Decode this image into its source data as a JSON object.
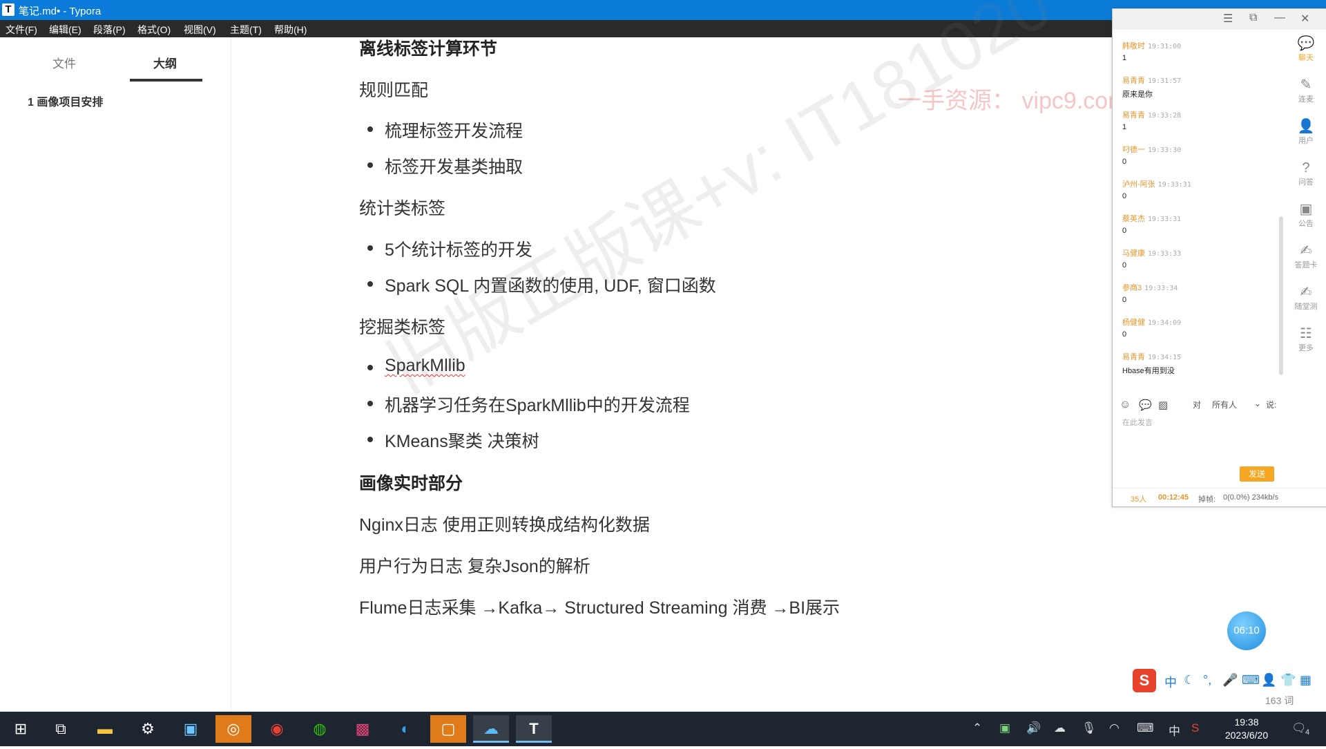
{
  "window": {
    "app_icon": "T",
    "title": "笔记.md• - Typora"
  },
  "menu": [
    "文件(F)",
    "编辑(E)",
    "段落(P)",
    "格式(O)",
    "视图(V)",
    "主题(T)",
    "帮助(H)"
  ],
  "sidebar": {
    "tabs": [
      "文件",
      "大纲"
    ],
    "active_tab": "大纲",
    "outline": [
      "1 画像项目安排"
    ],
    "bottom": {
      "back": "‹",
      "source": "</>"
    }
  },
  "editor": {
    "lines": [
      {
        "kind": "heading",
        "text": "离线标签计算环节"
      },
      {
        "kind": "para",
        "text": "规则匹配"
      },
      {
        "kind": "bullet",
        "text": "梳理标签开发流程"
      },
      {
        "kind": "bullet",
        "text": "标签开发基类抽取"
      },
      {
        "kind": "para",
        "text": "统计类标签"
      },
      {
        "kind": "bullet",
        "text": "5个统计标签的开发"
      },
      {
        "kind": "bullet",
        "text": "Spark SQL 内置函数的使用, UDF, 窗口函数"
      },
      {
        "kind": "para",
        "text": "挖掘类标签"
      },
      {
        "kind": "bullet",
        "text": "SparkMllib"
      },
      {
        "kind": "bullet",
        "text": "机器学习任务在SparkMllib中的开发流程"
      },
      {
        "kind": "bullet",
        "text": "KMeans聚类 决策树"
      },
      {
        "kind": "heading",
        "text": "画像实时部分"
      },
      {
        "kind": "para",
        "text": "Nginx日志  使用正则转换成结构化数据"
      },
      {
        "kind": "para",
        "text": "用户行为日志  复杂Json的解析"
      },
      {
        "kind": "para",
        "text": "Flume日志采集 →Kafka→ Structured Streaming 消费 →BI展示"
      }
    ],
    "watermark": "旧版正版课+v: IT181020",
    "resource_mark": "一手资源：  vipc9.com",
    "word_count": "163 词"
  },
  "chat": {
    "messages": [
      {
        "name": "韩敬时",
        "time": "19:31:00",
        "text": "1"
      },
      {
        "name": "易青青",
        "time": "19:31:57",
        "text": "原来是你"
      },
      {
        "name": "易青青",
        "time": "19:33:28",
        "text": "1"
      },
      {
        "name": "叼德一",
        "time": "19:33:30",
        "text": "0"
      },
      {
        "name": "泸州-阿张",
        "time": "19:33:31",
        "text": "0"
      },
      {
        "name": "蔡英杰",
        "time": "19:33:31",
        "text": "0"
      },
      {
        "name": "马健康",
        "time": "19:33:33",
        "text": "0"
      },
      {
        "name": "参商3",
        "time": "19:33:34",
        "text": "0"
      },
      {
        "name": "杨健健",
        "time": "19:34:09",
        "text": "0"
      },
      {
        "name": "易青青",
        "time": "19:34:15",
        "text": "Hbase有用到没"
      }
    ],
    "nav": [
      {
        "icon": "chat-icon",
        "glyph": "💬",
        "label": "聊天",
        "active": true
      },
      {
        "icon": "mic-icon",
        "glyph": "✎",
        "label": "连麦",
        "active": false
      },
      {
        "icon": "user-icon",
        "glyph": "👤",
        "label": "用户",
        "active": false
      },
      {
        "icon": "question-icon",
        "glyph": "?",
        "label": "问答",
        "active": false
      },
      {
        "icon": "notice-icon",
        "glyph": "▣",
        "label": "公告",
        "active": false
      },
      {
        "icon": "answer-card-icon",
        "glyph": "✍",
        "label": "答题卡",
        "active": false
      },
      {
        "icon": "quiz-icon",
        "glyph": "✍",
        "label": "随堂测",
        "active": false
      },
      {
        "icon": "more-icon",
        "glyph": "☷",
        "label": "更多",
        "active": false
      }
    ],
    "target_prefix": "对",
    "target": "所有人",
    "say": "说:",
    "input_placeholder": "在此发言",
    "send": "发送",
    "status": {
      "people": "35人",
      "duration": "00:12:45",
      "drop_label": "掉帧:",
      "drop_value": "0(0.0%) 234kb/s"
    }
  },
  "timer": "06:10",
  "ime": {
    "logo": "S",
    "lang": "中"
  },
  "taskbar": {
    "clock_time": "19:38",
    "clock_date": "2023/6/20",
    "tray_lang": "中",
    "notification_count": "4"
  }
}
